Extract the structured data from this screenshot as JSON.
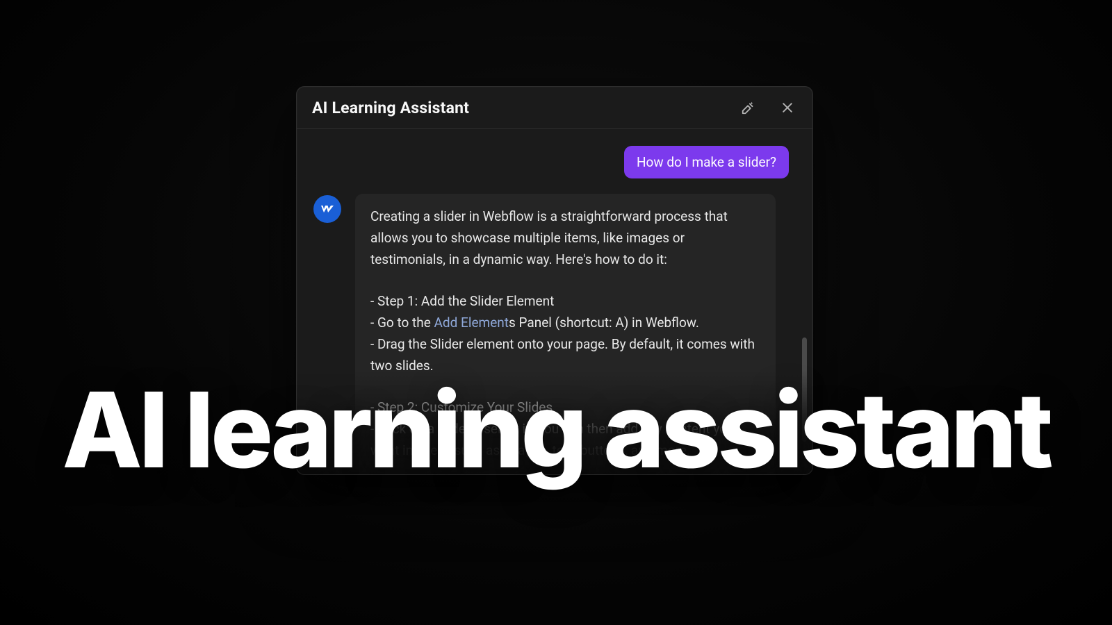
{
  "panel": {
    "title": "AI Learning Assistant"
  },
  "chat": {
    "user_message": "How do I make a slider?",
    "assistant": {
      "intro": "Creating a slider in Webflow is a straightforward process that allows you to showcase multiple items, like images or testimonials, in a dynamic way. Here's how to do it:",
      "step1_title": "- Step 1: Add the Slider Element",
      "step1_a_prefix": "  - Go to the ",
      "step1_a_link": "Add Element",
      "step1_a_suffix": "s Panel (shortcut: A) in Webflow.",
      "step1_b": "  - Drag the Slider element onto your page. By default, it comes with two slides.",
      "step2_title": "- Step 2: Customize Your Slides",
      "step2_a": "  - Click on a slide to select it. You can then add any content you want inside — such as images, text, buttons, and more."
    }
  },
  "headline": "AI learning assistant",
  "colors": {
    "accent": "#7c3aed",
    "avatar_bg": "#1a5fd6",
    "link": "#8fa8d9"
  }
}
